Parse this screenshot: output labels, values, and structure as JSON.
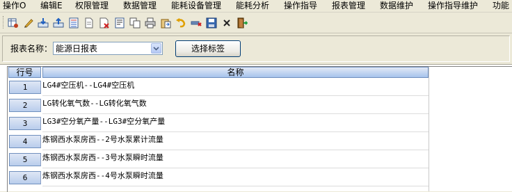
{
  "menu": [
    "操作O",
    "编辑E",
    "权限管理",
    "数据管理",
    "能耗设备管理",
    "能耗分析",
    "操作指导",
    "报表管理",
    "数据维护",
    "操作指导维护",
    "功能"
  ],
  "toolbar": {
    "icons": [
      "table-settings-icon",
      "pencil-icon",
      "import-icon",
      "export-icon",
      "list-icon",
      "document-icon",
      "delete-document-icon",
      "report-icon",
      "copy-icon",
      "print-icon",
      "paste-icon",
      "undo-icon",
      "remove-row-icon",
      "save-icon",
      "close-icon",
      "exit-door-icon"
    ]
  },
  "filter": {
    "label": "报表名称：",
    "selected_report": "能源日报表",
    "choose_button": "选择标签"
  },
  "grid": {
    "columns": [
      "行号",
      "名称"
    ],
    "rows": [
      {
        "num": "1",
        "name": "LG4#空压机--LG4#空压机"
      },
      {
        "num": "2",
        "name": "LG转化氧气数--LG转化氧气数"
      },
      {
        "num": "3",
        "name": "LG3#空分氧产量--LG3#空分氧产量"
      },
      {
        "num": "4",
        "name": "炼钢西水泵房西--2号水泵累计流量"
      },
      {
        "num": "5",
        "name": "炼钢西水泵房西--3号水泵瞬时流量"
      },
      {
        "num": "6",
        "name": "炼钢西水泵房西--4号水泵瞬时流量"
      }
    ]
  }
}
